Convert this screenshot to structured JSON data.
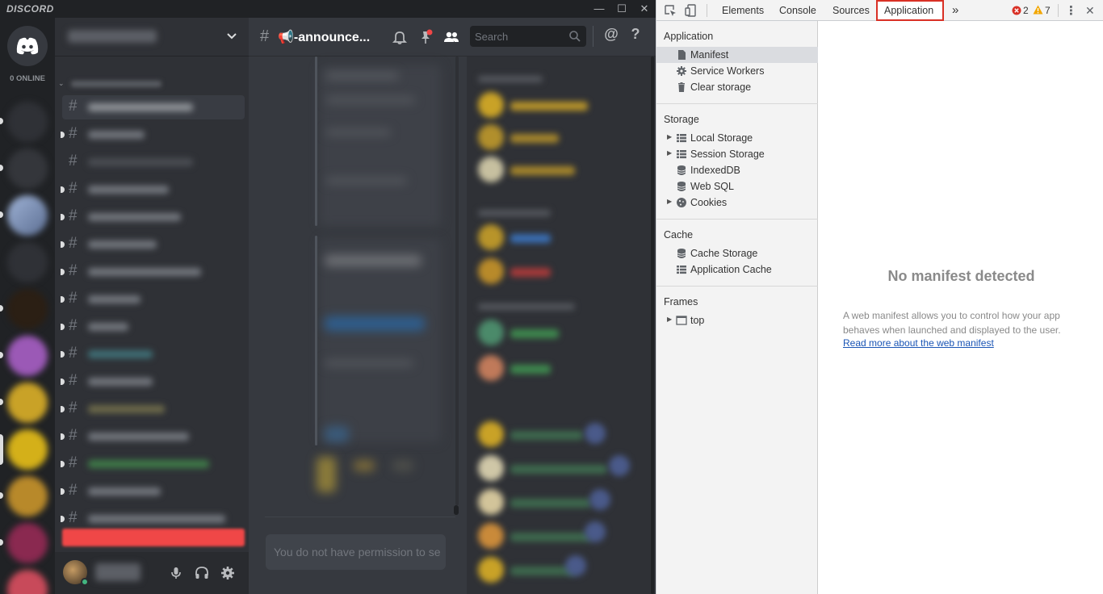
{
  "discord": {
    "brand": "DISCORD",
    "online_count": "0 ONLINE",
    "window_controls": {
      "minimize": "—",
      "maximize": "☐",
      "close": "✕"
    },
    "channel_prefix": "#",
    "channel_title": "📢-announce...",
    "search_placeholder": "Search",
    "composer_placeholder": "You do not have permission to se",
    "user_controls": [
      "mic-icon",
      "headphones-icon",
      "settings-icon"
    ],
    "header_icons": [
      "bell-icon",
      "pin-icon",
      "members-icon",
      "mention-icon",
      "help-icon"
    ],
    "mention_glyph": "@",
    "help_glyph": "?",
    "colors": {
      "bg_dark": "#202225",
      "sidebar": "#2f3136",
      "chat": "#36393f",
      "online_green": "#43b581",
      "alert_red": "#f04747",
      "notification_red": "#f04747"
    }
  },
  "devtools": {
    "tabs": [
      {
        "label": "Elements"
      },
      {
        "label": "Console"
      },
      {
        "label": "Sources"
      },
      {
        "label": "Application"
      }
    ],
    "more_tabs": "»",
    "errors": "2",
    "warnings": "7",
    "menu_glyph": "⋮",
    "close_glyph": "✕",
    "sidebar": {
      "application": {
        "title": "Application",
        "items": [
          "Manifest",
          "Service Workers",
          "Clear storage"
        ]
      },
      "storage": {
        "title": "Storage",
        "items": [
          "Local Storage",
          "Session Storage",
          "IndexedDB",
          "Web SQL",
          "Cookies"
        ]
      },
      "cache": {
        "title": "Cache",
        "items": [
          "Cache Storage",
          "Application Cache"
        ]
      },
      "frames": {
        "title": "Frames",
        "items": [
          "top"
        ]
      }
    },
    "main": {
      "heading": "No manifest detected",
      "description": "A web manifest allows you to control how your app behaves when launched and displayed to the user.",
      "link": "Read more about the web manifest"
    },
    "colors": {
      "active_tab_border": "#d93025",
      "link": "#1a55b5",
      "error": "#d93025",
      "warning": "#f2a600"
    }
  }
}
